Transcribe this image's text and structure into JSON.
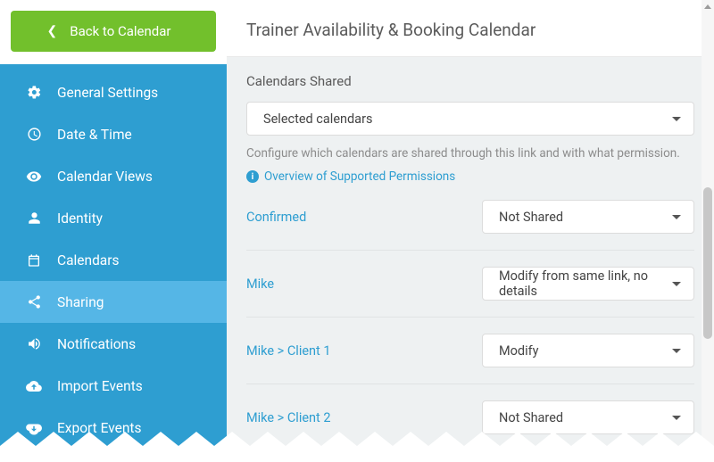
{
  "back_label": "Back to Calendar",
  "page_title": "Trainer Availability & Booking Calendar",
  "sidebar": {
    "items": [
      {
        "label": "General Settings",
        "active": false
      },
      {
        "label": "Date & Time",
        "active": false
      },
      {
        "label": "Calendar Views",
        "active": false
      },
      {
        "label": "Identity",
        "active": false
      },
      {
        "label": "Calendars",
        "active": false
      },
      {
        "label": "Sharing",
        "active": true
      },
      {
        "label": "Notifications",
        "active": false
      },
      {
        "label": "Import Events",
        "active": false
      },
      {
        "label": "Export Events",
        "active": false
      }
    ]
  },
  "section": {
    "title": "Calendars Shared",
    "main_select": "Selected calendars",
    "helper": "Configure which calendars are shared through this link and with what permission.",
    "permissions_link": "Overview of Supported Permissions"
  },
  "calendars": [
    {
      "name": "Confirmed",
      "permission": "Not Shared"
    },
    {
      "name": "Mike",
      "permission": "Modify from same link, no details"
    },
    {
      "name": "Mike > Client 1",
      "permission": "Modify"
    },
    {
      "name": "Mike > Client 2",
      "permission": "Not Shared"
    }
  ]
}
